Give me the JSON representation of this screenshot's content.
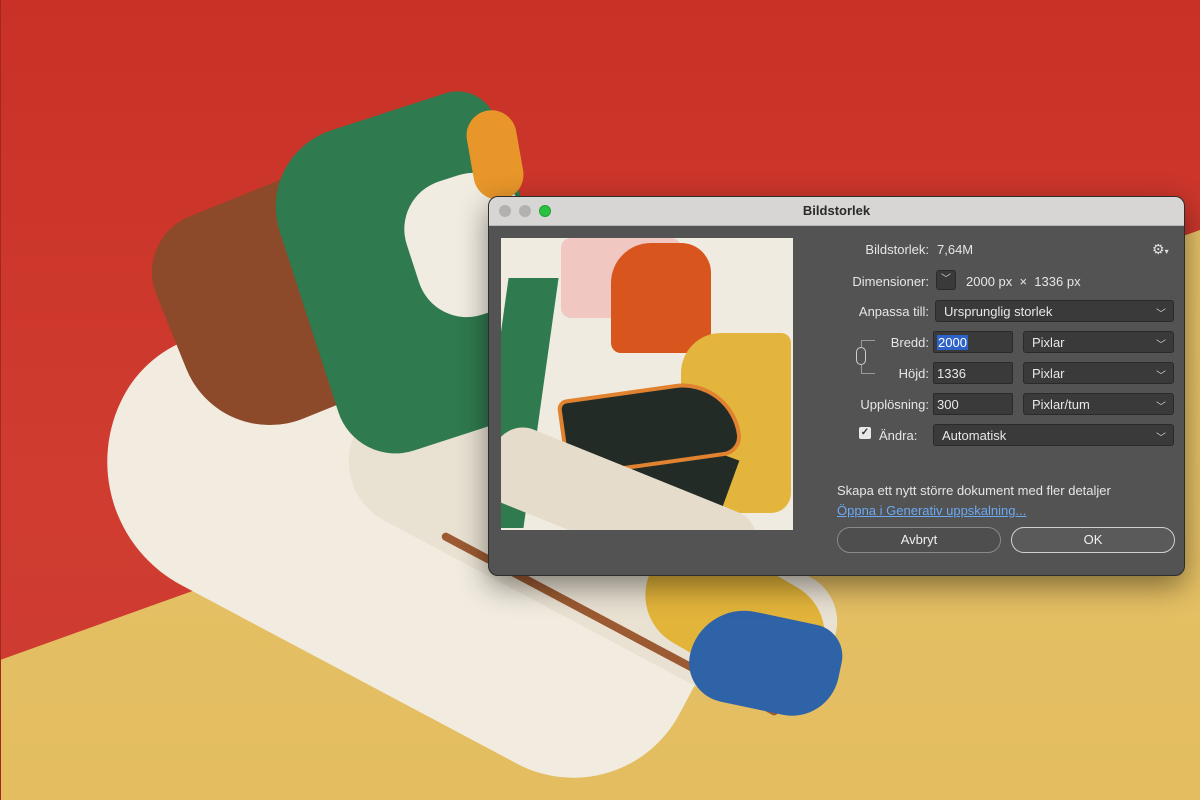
{
  "dialog": {
    "title": "Bildstorlek",
    "image_size": {
      "label": "Bildstorlek:",
      "value": "7,64M"
    },
    "dimensions": {
      "label": "Dimensioner:",
      "value": "2000 px  ×  1336 px"
    },
    "fit_to": {
      "label": "Anpassa till:",
      "value": "Ursprunglig storlek"
    },
    "width": {
      "label": "Bredd:",
      "value": "2000",
      "unit": "Pixlar"
    },
    "height": {
      "label": "Höjd:",
      "value": "1336",
      "unit": "Pixlar"
    },
    "resolution": {
      "label": "Upplösning:",
      "value": "300",
      "unit": "Pixlar/tum"
    },
    "resample": {
      "label": "Ändra:",
      "checked": true,
      "value": "Automatisk"
    },
    "info_text": "Skapa ett nytt större dokument med fler detaljer",
    "link_text": "Öppna i Generativ uppskalning...",
    "cancel_label": "Avbryt",
    "ok_label": "OK"
  },
  "icons": {
    "gear": "gear-icon",
    "chevron": "chevron-down-icon",
    "chain": "link-icon",
    "check": "checkmark-icon"
  },
  "colors": {
    "dialog_bg": "#535353",
    "titlebar_bg": "#d8d6d4",
    "zoom_light": "#2cc13f",
    "link": "#6aa9f4",
    "selection": "#2d62c8"
  }
}
